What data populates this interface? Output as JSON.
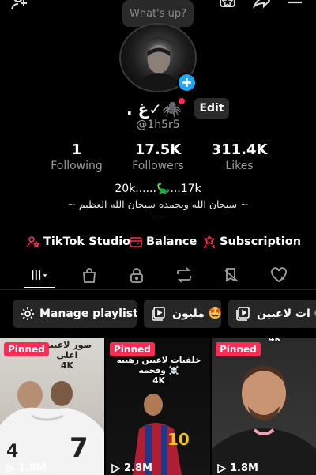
{
  "top": {
    "status_placeholder": "What's up?"
  },
  "profile": {
    "display_name": ". غ✓🕷️",
    "edit_label": "Edit",
    "username": "@1h5r5"
  },
  "stats": [
    {
      "value": "1",
      "label": "Following"
    },
    {
      "value": "17.5K",
      "label": "Followers"
    },
    {
      "value": "311.4K",
      "label": "Likes"
    }
  ],
  "bio": {
    "line1": "20k......🦕...17k",
    "line2": "~ سبحان الله وبحمده سبحان الله العظيم ~",
    "line3": "---"
  },
  "links": {
    "studio": "TikTok Studio",
    "balance": "Balance",
    "subscription": "Subscription"
  },
  "playlists": {
    "manage": "Manage playlists",
    "items": [
      "مليون 🤩",
      "ات لاعبين ⚽"
    ]
  },
  "videos": [
    {
      "badge": "Pinned",
      "views": "1.8M",
      "caption": "صور لاعبين اعلى\n4K"
    },
    {
      "badge": "Pinned",
      "views": "2.8M",
      "caption": "خلفيات لاعبين رهيبه\nوفخمه ☠️\n4K"
    },
    {
      "badge": "Pinned",
      "views": "1.8M",
      "caption": "4K"
    }
  ],
  "colors": {
    "accent": "#fe2c55",
    "badge_blue": "#20a6f0",
    "chip_bg": "#262626"
  },
  "icons": [
    "add-user-icon",
    "star-box-icon",
    "share-icon",
    "menu-icon",
    "plus-icon",
    "person-star-icon",
    "wallet-icon",
    "subscription-icon",
    "grid-icon",
    "bag-icon",
    "lock-icon",
    "repost-icon",
    "hidden-like-icon",
    "heart-hidden-icon",
    "gear-icon",
    "playlist-icon",
    "play-icon"
  ]
}
